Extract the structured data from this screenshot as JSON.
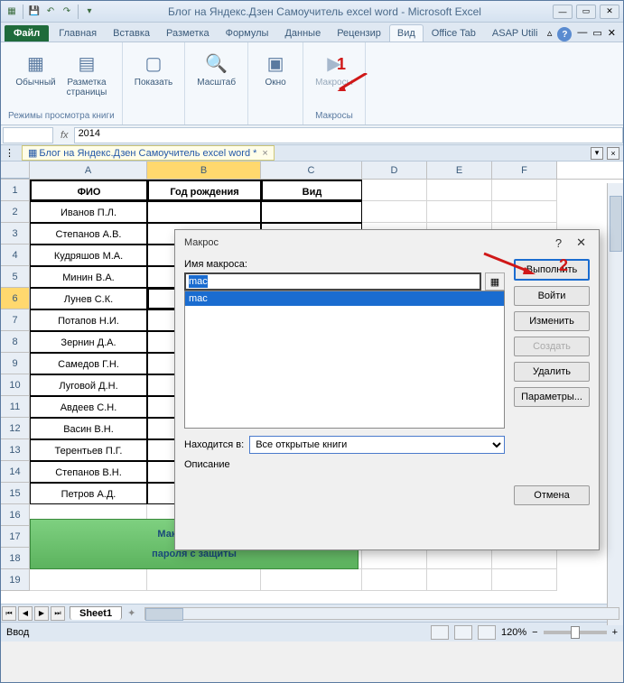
{
  "title": "Блог на Яндекс.Дзен Самоучитель excel word  -  Microsoft Excel",
  "tabs": {
    "file": "Файл",
    "home": "Главная",
    "insert": "Вставка",
    "layout": "Разметка",
    "formulas": "Формулы",
    "data": "Данные",
    "review": "Рецензир",
    "view": "Вид",
    "office": "Office Tab",
    "asap": "ASAP Utili"
  },
  "ribbon": {
    "normal": "Обычный",
    "page": "Разметка\nстраницы",
    "modes": "Режимы просмотра книги",
    "show": "Показать",
    "zoom": "Масштаб",
    "window": "Окно",
    "macros": "Макросы",
    "macros_grp": "Макросы"
  },
  "formula_value": "2014",
  "doc_tab": "Блог на Яндекс.Дзен Самоучитель excel word *",
  "cols": {
    "A": "A",
    "B": "B",
    "C": "C",
    "D": "D",
    "E": "E",
    "F": "F"
  },
  "col_widths": {
    "A": 130,
    "B": 126,
    "C": 112,
    "D": 72,
    "E": 72,
    "F": 72
  },
  "headers": {
    "A": "ФИО",
    "B": "Год рождения",
    "C": "Вид"
  },
  "rows": [
    "Иванов П.Л.",
    "Степанов А.В.",
    "Кудряшов М.А.",
    "Минин В.А.",
    "Лунев С.К.",
    "Потапов Н.И.",
    "Зернин Д.А.",
    "Самедов Г.Н.",
    "Луговой Д.Н.",
    "Авдеев С.Н.",
    "Васин В.Н.",
    "Терентьев П.Г.",
    "Степанов В.Н.",
    "Петров А.Д."
  ],
  "banner": "Макрос снятия\nпароля с защиты",
  "sheet": "Sheet1",
  "status": "Ввод",
  "zoom": "120%",
  "dialog": {
    "title": "Макрос",
    "name_label": "Имя макроса:",
    "name_value": "mac",
    "list": [
      "mac"
    ],
    "loc_label": "Находится в:",
    "loc_value": "Все открытые книги",
    "desc_label": "Описание",
    "run": "Выполнить",
    "step": "Войти",
    "edit": "Изменить",
    "create": "Создать",
    "delete": "Удалить",
    "opts": "Параметры...",
    "cancel": "Отмена"
  },
  "ann": {
    "1": "1",
    "2": "2"
  }
}
